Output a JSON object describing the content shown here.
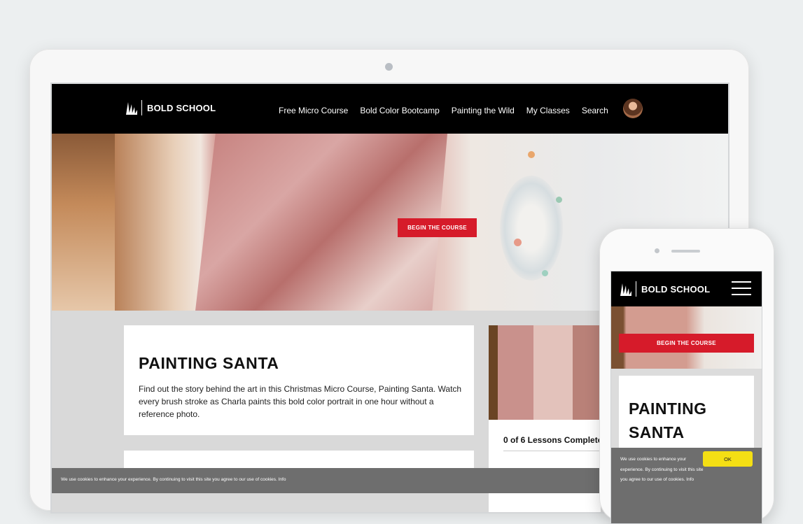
{
  "brand": {
    "name": "BOLD SCHOOL"
  },
  "nav": {
    "items": [
      "Free Micro Course",
      "Bold Color Bootcamp",
      "Painting the Wild",
      "My Classes",
      "Search"
    ]
  },
  "hero": {
    "cta_label": "BEGIN THE COURSE"
  },
  "course": {
    "title": "PAINTING SANTA",
    "description": "Find out the story behind the art in this Christmas Micro Course, Painting Santa. Watch every brush stroke as Charla paints this bold color portrait in one hour without a reference photo."
  },
  "progress": {
    "lessons_label": "0 of 6 Lessons Complete"
  },
  "cookie": {
    "text": "We use cookies to enhance your experience. By continuing to visit this site you agree to our use of cookies. Info",
    "ok_label": "OK"
  },
  "mobile": {
    "title": "PAINTING SANTA",
    "menu_icon": "hamburger-icon"
  },
  "colors": {
    "header_bg": "#000000",
    "accent_red": "#d61b2a",
    "cookie_bg": "#6e6e6e",
    "ok_button": "#f4df14"
  }
}
